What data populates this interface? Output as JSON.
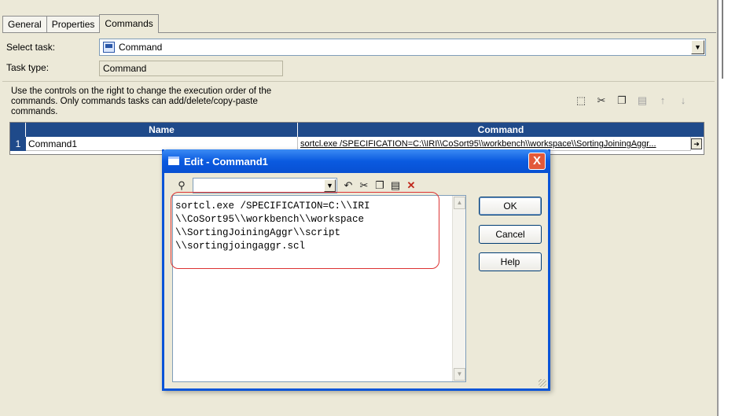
{
  "tabs": [
    {
      "label": "General"
    },
    {
      "label": "Properties"
    },
    {
      "label": "Commands"
    }
  ],
  "active_tab": "Commands",
  "form": {
    "select_task_label": "Select task:",
    "select_task_value": "Command",
    "task_type_label": "Task type:",
    "task_type_value": "Command"
  },
  "help_text": "Use the controls on the right to change the execution order of the commands.  Only commands tasks can add/delete/copy-paste commands.",
  "toolbar_icons": [
    "new-icon",
    "cut-icon",
    "copy-icon",
    "paste-icon",
    "move-up-icon",
    "move-down-icon"
  ],
  "table": {
    "columns": [
      "Name",
      "Command"
    ],
    "rows": [
      {
        "num": "1",
        "name": "Command1",
        "command": "sortcl.exe /SPECIFICATION=C:\\\\IRI\\\\CoSort95\\\\workbench\\\\workspace\\\\SortingJoiningAggr..."
      }
    ]
  },
  "dialog": {
    "title": "Edit  - Command1",
    "close_label": "X",
    "toolbar_icons": [
      "binoculars-icon",
      "undo-icon",
      "cut-icon",
      "copy-icon",
      "paste-icon",
      "delete-icon"
    ],
    "find_value": "",
    "editor_lines": [
      "sortcl.exe /SPECIFICATION=C:\\\\IRI",
      "\\\\CoSort95\\\\workbench\\\\workspace",
      "\\\\SortingJoiningAggr\\\\script",
      "\\\\sortingjoingaggr.scl"
    ],
    "buttons": {
      "ok": "OK",
      "cancel": "Cancel",
      "help": "Help"
    }
  },
  "colors": {
    "panel_bg": "#ece9d8",
    "grid_header": "#1f4a8a",
    "titlebar": "#0a5ae0",
    "highlight": "#dd3333"
  }
}
